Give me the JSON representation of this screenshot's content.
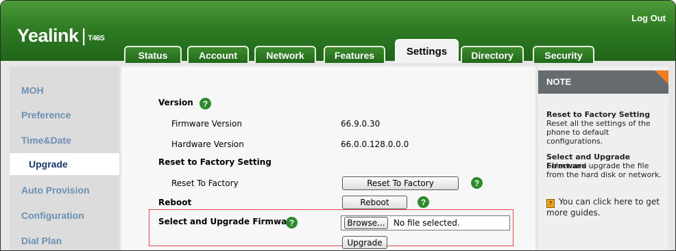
{
  "header": {
    "brand": "Yealink",
    "model": "T46S",
    "logout": "Log Out"
  },
  "tabs": [
    {
      "label": "Status",
      "active": false
    },
    {
      "label": "Account",
      "active": false
    },
    {
      "label": "Network",
      "active": false
    },
    {
      "label": "Features",
      "active": false
    },
    {
      "label": "Settings",
      "active": true
    },
    {
      "label": "Directory",
      "active": false
    },
    {
      "label": "Security",
      "active": false
    }
  ],
  "sidebar": {
    "items": [
      {
        "label": "MOH"
      },
      {
        "label": "Preference"
      },
      {
        "label": "Time&Date"
      },
      {
        "label": "Upgrade",
        "active": true
      },
      {
        "label": "Auto Provision"
      },
      {
        "label": "Configuration"
      },
      {
        "label": "Dial Plan"
      }
    ]
  },
  "main": {
    "version_title": "Version",
    "firmware_label": "Firmware Version",
    "firmware_value": "66.9.0.30",
    "hardware_label": "Hardware Version",
    "hardware_value": "66.0.0.128.0.0.0",
    "reset_section": "Reset to Factory Setting",
    "reset_label": "Reset To Factory",
    "reset_button": "Reset To Factory",
    "reboot_section": "Reboot",
    "reboot_button": "Reboot",
    "upgrade_section": "Select and Upgrade Firmware",
    "browse_button": "Browse...",
    "file_status": "No file selected.",
    "upgrade_button": "Upgrade",
    "help_glyph": "?"
  },
  "note": {
    "title": "NOTE",
    "reset_title": "Reset to Factory Setting",
    "reset_text": "Reset all the settings of the phone to default configurations.",
    "upgrade_title": "Select and Upgrade Firmware",
    "upgrade_text": "Select and upgrade the file from the hard disk or network.",
    "guide_text": "You can click here to get more guides."
  },
  "colors": {
    "header_green": "#2f7c24",
    "accent_orange": "#f47a20",
    "highlight_red": "#e0474c",
    "help_green": "#2d8a2c"
  },
  "icons": [
    "help-icon",
    "guide-book-icon",
    "note-corner-icon"
  ]
}
